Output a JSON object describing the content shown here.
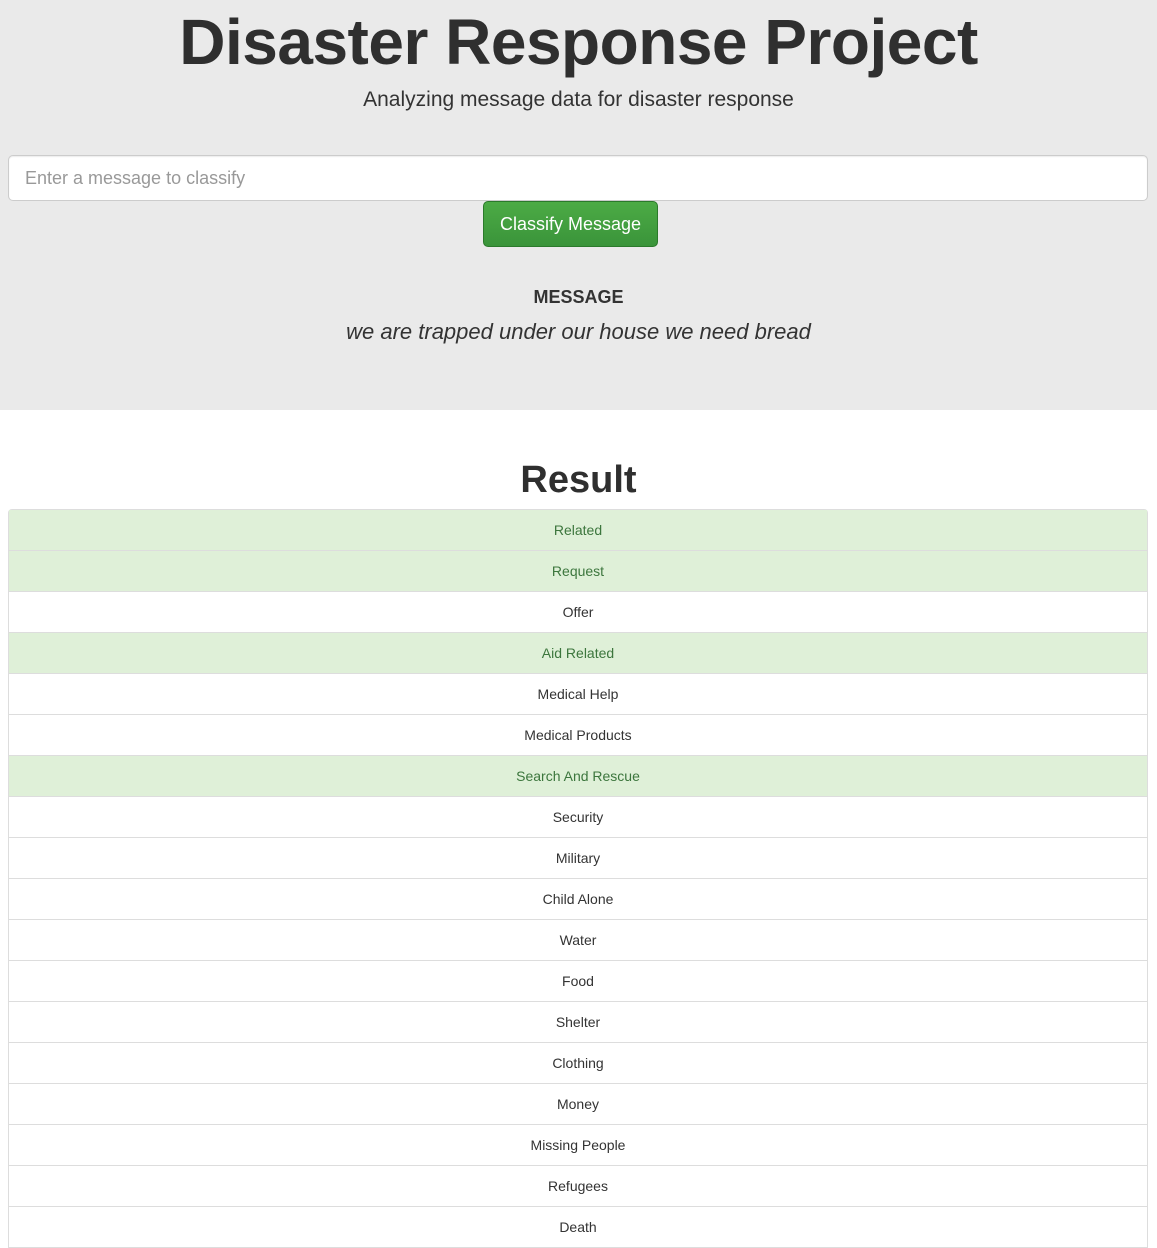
{
  "header": {
    "title": "Disaster Response Project",
    "subtitle": "Analyzing message data for disaster response"
  },
  "form": {
    "input_placeholder": "Enter a message to classify",
    "input_value": "",
    "button_label": "Classify Message"
  },
  "message": {
    "heading": "MESSAGE",
    "text": "we are trapped under our house we need bread"
  },
  "colors": {
    "positive_bg": "#dff0d8",
    "positive_text": "#3c763d",
    "button_green": "#3f9e3f"
  },
  "result": {
    "title": "Result",
    "categories": [
      {
        "label": "Related",
        "positive": true
      },
      {
        "label": "Request",
        "positive": true
      },
      {
        "label": "Offer",
        "positive": false
      },
      {
        "label": "Aid Related",
        "positive": true
      },
      {
        "label": "Medical Help",
        "positive": false
      },
      {
        "label": "Medical Products",
        "positive": false
      },
      {
        "label": "Search And Rescue",
        "positive": true
      },
      {
        "label": "Security",
        "positive": false
      },
      {
        "label": "Military",
        "positive": false
      },
      {
        "label": "Child Alone",
        "positive": false
      },
      {
        "label": "Water",
        "positive": false
      },
      {
        "label": "Food",
        "positive": false
      },
      {
        "label": "Shelter",
        "positive": false
      },
      {
        "label": "Clothing",
        "positive": false
      },
      {
        "label": "Money",
        "positive": false
      },
      {
        "label": "Missing People",
        "positive": false
      },
      {
        "label": "Refugees",
        "positive": false
      },
      {
        "label": "Death",
        "positive": false
      }
    ]
  }
}
